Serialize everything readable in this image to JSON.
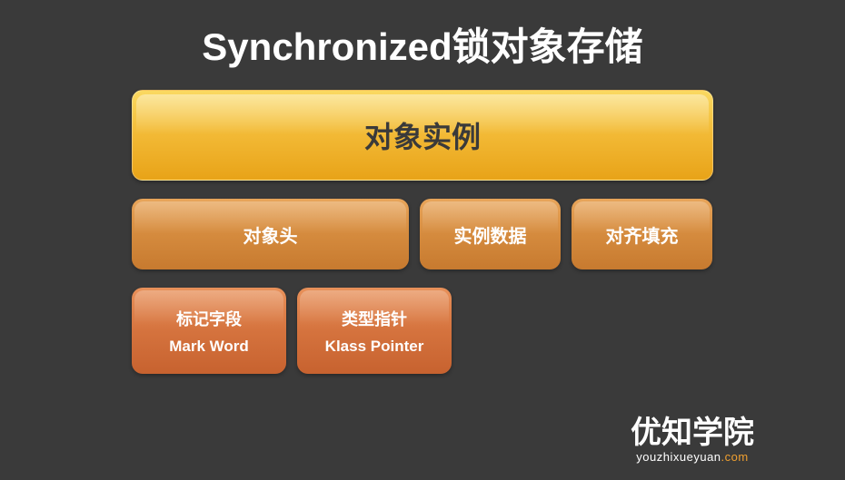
{
  "title": "Synchronized锁对象存储",
  "level1": {
    "label": "对象实例"
  },
  "level2": {
    "header": "对象头",
    "data": "实例数据",
    "padding": "对齐填充"
  },
  "level3": {
    "markword_cn": "标记字段",
    "markword_en": "Mark Word",
    "klass_cn": "类型指针",
    "klass_en": "Klass Pointer"
  },
  "footer": {
    "brand": "优知学院",
    "url_prefix": "youzhixueyuan",
    "url_suffix": ".com"
  }
}
